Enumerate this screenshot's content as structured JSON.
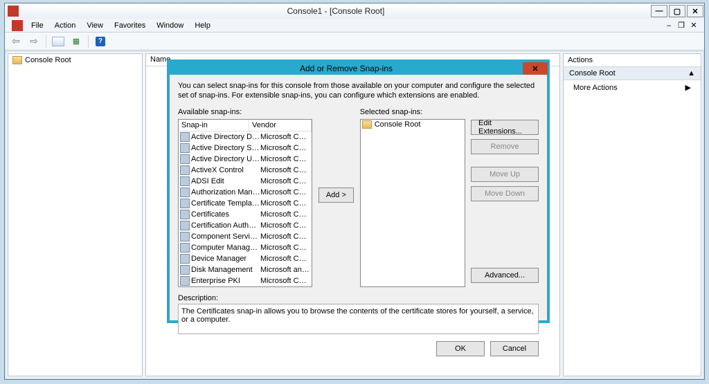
{
  "outer": {
    "title": "Console1 - [Console Root]",
    "menus": [
      "File",
      "Action",
      "View",
      "Favorites",
      "Window",
      "Help"
    ]
  },
  "tree": {
    "root": "Console Root"
  },
  "main": {
    "nameHeader": "Name"
  },
  "actions": {
    "header": "Actions",
    "section": "Console Root",
    "more": "More Actions"
  },
  "dialog": {
    "title": "Add or Remove Snap-ins",
    "intro": "You can select snap-ins for this console from those available on your computer and configure the selected set of snap-ins. For extensible snap-ins, you can configure which extensions are enabled.",
    "availableLabel": "Available snap-ins:",
    "selectedLabel": "Selected snap-ins:",
    "descriptionLabel": "Description:",
    "description": "The Certificates snap-in allows you to browse the contents of the certificate stores for yourself, a service, or a computer.",
    "columns": {
      "snapin": "Snap-in",
      "vendor": "Vendor"
    },
    "available": [
      {
        "name": "Active Directory Do...",
        "vendor": "Microsoft Cor..."
      },
      {
        "name": "Active Directory Site...",
        "vendor": "Microsoft Cor..."
      },
      {
        "name": "Active Directory Use...",
        "vendor": "Microsoft Cor..."
      },
      {
        "name": "ActiveX Control",
        "vendor": "Microsoft Cor..."
      },
      {
        "name": "ADSI Edit",
        "vendor": "Microsoft Cor..."
      },
      {
        "name": "Authorization Manager",
        "vendor": "Microsoft Cor..."
      },
      {
        "name": "Certificate Templates",
        "vendor": "Microsoft Cor..."
      },
      {
        "name": "Certificates",
        "vendor": "Microsoft Cor..."
      },
      {
        "name": "Certification Authority",
        "vendor": "Microsoft Cor..."
      },
      {
        "name": "Component Services",
        "vendor": "Microsoft Cor..."
      },
      {
        "name": "Computer Managem...",
        "vendor": "Microsoft Cor..."
      },
      {
        "name": "Device Manager",
        "vendor": "Microsoft Cor..."
      },
      {
        "name": "Disk Management",
        "vendor": "Microsoft and..."
      },
      {
        "name": "Enterprise PKI",
        "vendor": "Microsoft Cor..."
      }
    ],
    "selected": [
      {
        "name": "Console Root"
      }
    ],
    "buttons": {
      "add": "Add >",
      "editExt": "Edit Extensions...",
      "remove": "Remove",
      "moveUp": "Move Up",
      "moveDown": "Move Down",
      "advanced": "Advanced...",
      "ok": "OK",
      "cancel": "Cancel"
    }
  }
}
